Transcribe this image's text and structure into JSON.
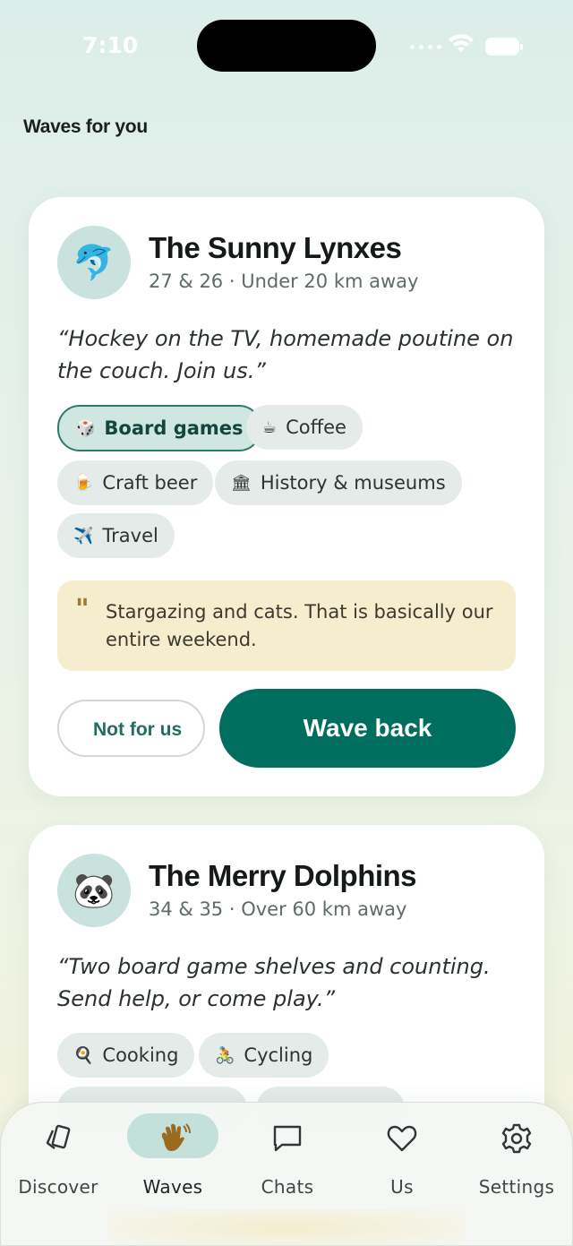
{
  "status_bar": {
    "time": "7:10"
  },
  "section_title": "Waves for you",
  "cards": [
    {
      "avatar_emoji": "🐬",
      "name": "The Sunny Lynxes",
      "meta": "27 & 26 · Under 20 km away",
      "quote": "“Hockey on the TV, homemade poutine on the couch. Join us.”",
      "interests": [
        {
          "emoji": "🎲",
          "label": "Board games",
          "selected": true
        },
        {
          "emoji": "☕",
          "label": "Coffee",
          "selected": false
        },
        {
          "emoji": "🍺",
          "label": "Craft beer",
          "selected": false
        },
        {
          "emoji": "🏛",
          "label": "History & museums",
          "selected": false
        },
        {
          "emoji": "✈️",
          "label": "Travel",
          "selected": false
        }
      ],
      "note": "Stargazing and cats. That is basically our entire weekend.",
      "decline_label": "Not for us",
      "accept_label": "Wave back"
    },
    {
      "avatar_emoji": "🐼",
      "name": "The Merry Dolphins",
      "meta": "34 & 35 · Over 60 km away",
      "quote": "“Two board game shelves and counting. Send help, or come play.”",
      "interests": [
        {
          "emoji": "🍳",
          "label": "Cooking",
          "selected": false
        },
        {
          "emoji": "🚴",
          "label": "Cycling",
          "selected": false
        }
      ]
    }
  ],
  "tabbar": {
    "active": "waves",
    "tabs": [
      {
        "id": "discover",
        "label": "Discover",
        "icon": "cards-icon"
      },
      {
        "id": "waves",
        "label": "Waves",
        "icon": "wave-hand-icon"
      },
      {
        "id": "chats",
        "label": "Chats",
        "icon": "chat-bubble-icon"
      },
      {
        "id": "us",
        "label": "Us",
        "icon": "heart-icon"
      },
      {
        "id": "settings",
        "label": "Settings",
        "icon": "gear-icon"
      }
    ]
  },
  "colors": {
    "accent": "#006e5f",
    "chip_bg": "#e4ebe9",
    "selected_chip_bg": "#cfe6e1",
    "note_bg": "#f5edcd"
  }
}
